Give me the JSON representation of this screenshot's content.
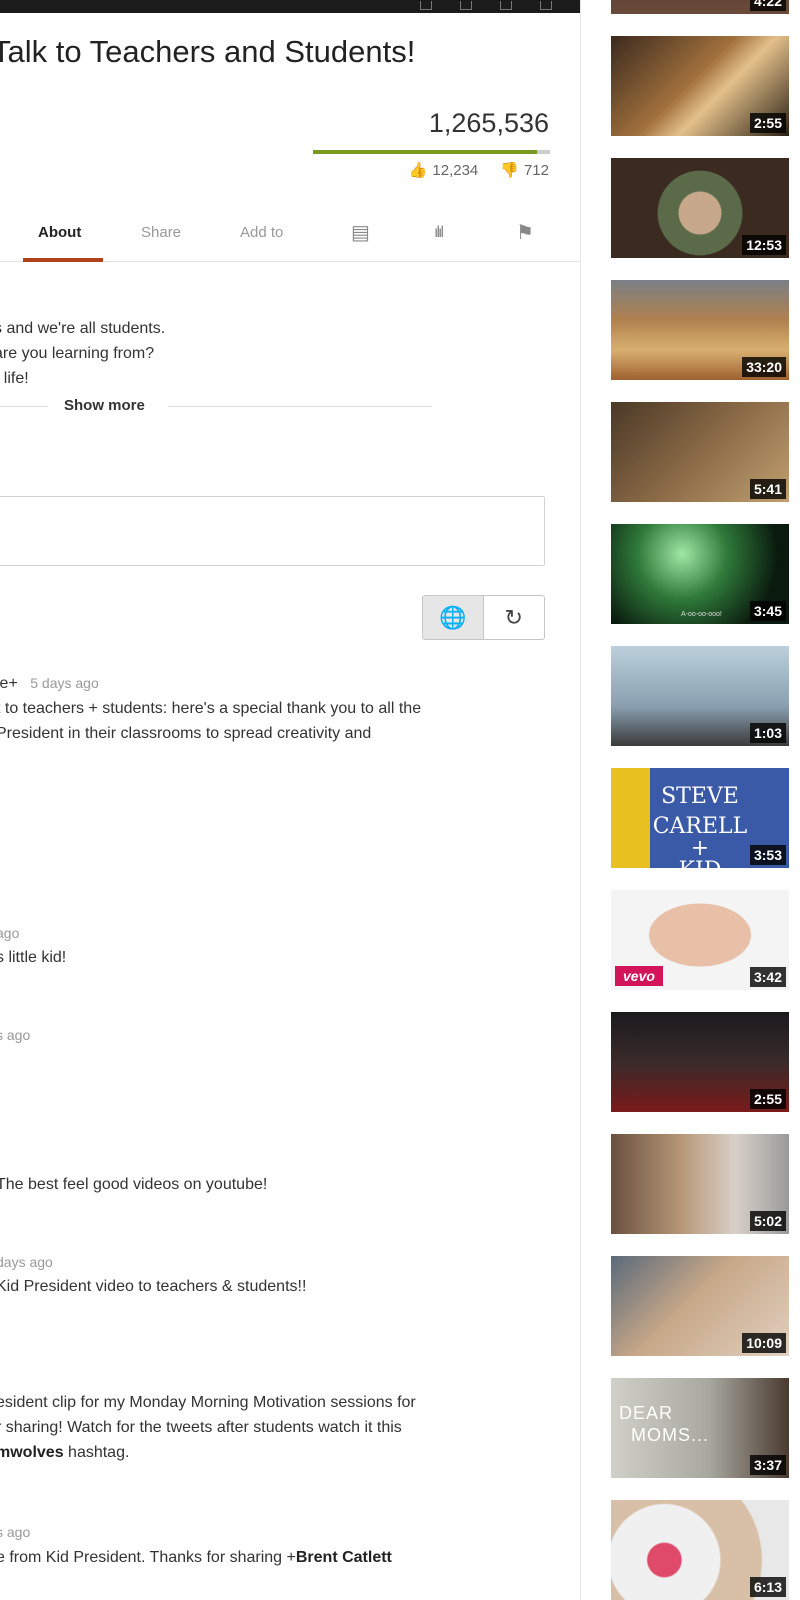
{
  "video": {
    "title": "Talk to Teachers and Students!",
    "views": "1,265,536",
    "likes": "12,234",
    "dislikes": "712",
    "like_ratio": 0.945
  },
  "tabs": [
    {
      "label": "About",
      "active": true
    },
    {
      "label": "Share",
      "active": false
    },
    {
      "label": "Add to",
      "active": false
    }
  ],
  "description": {
    "lines": [
      "s and we're all students.",
      "are you learning from?",
      "r life!"
    ],
    "show_more": "Show more"
  },
  "comments": [
    {
      "author": "le+",
      "time": "5 days ago",
      "lines": [
        "t to teachers + students: here's a special thank you to all the",
        "President in their classrooms to spread creativity and"
      ]
    },
    {
      "time": "ago",
      "lines": [
        "s little kid!"
      ]
    },
    {
      "time": "s ago",
      "lines": []
    },
    {
      "lines": [
        " The best feel good videos on youtube!"
      ]
    },
    {
      "time": "days ago",
      "lines": [
        " Kid President video to teachers & students!!"
      ]
    },
    {
      "lines": [
        "esident clip for my Monday Morning Motivation sessions for",
        "r sharing! Watch for the tweets after students watch it this"
      ],
      "bold_prefix": "mwolves",
      "tail": " hashtag."
    },
    {
      "time": "s ago",
      "text_before": "e from  Kid President. Thanks for sharing +",
      "bold": "Brent Catlett"
    }
  ],
  "sidebar": {
    "durations": [
      "4:22",
      "2:55",
      "12:53",
      "33:20",
      "5:41",
      "3:45",
      "1:03",
      "3:53",
      "3:42",
      "2:55",
      "5:02",
      "10:09",
      "3:37",
      "6:13"
    ],
    "overlay_text_steve": "STEVE CARELL",
    "overlay_text_plus": "+",
    "overlay_text_kid": "KID PRESIDENT",
    "overlay_text_dear": "DEAR",
    "overlay_text_moms": "MOMS...",
    "vevo": "vevo",
    "caption_small": "A-oo-oo-ooo!"
  },
  "colors": {
    "accent_tab": "#b0431c",
    "like_bar": "#7a9a1f",
    "vevo": "#d4145a"
  }
}
